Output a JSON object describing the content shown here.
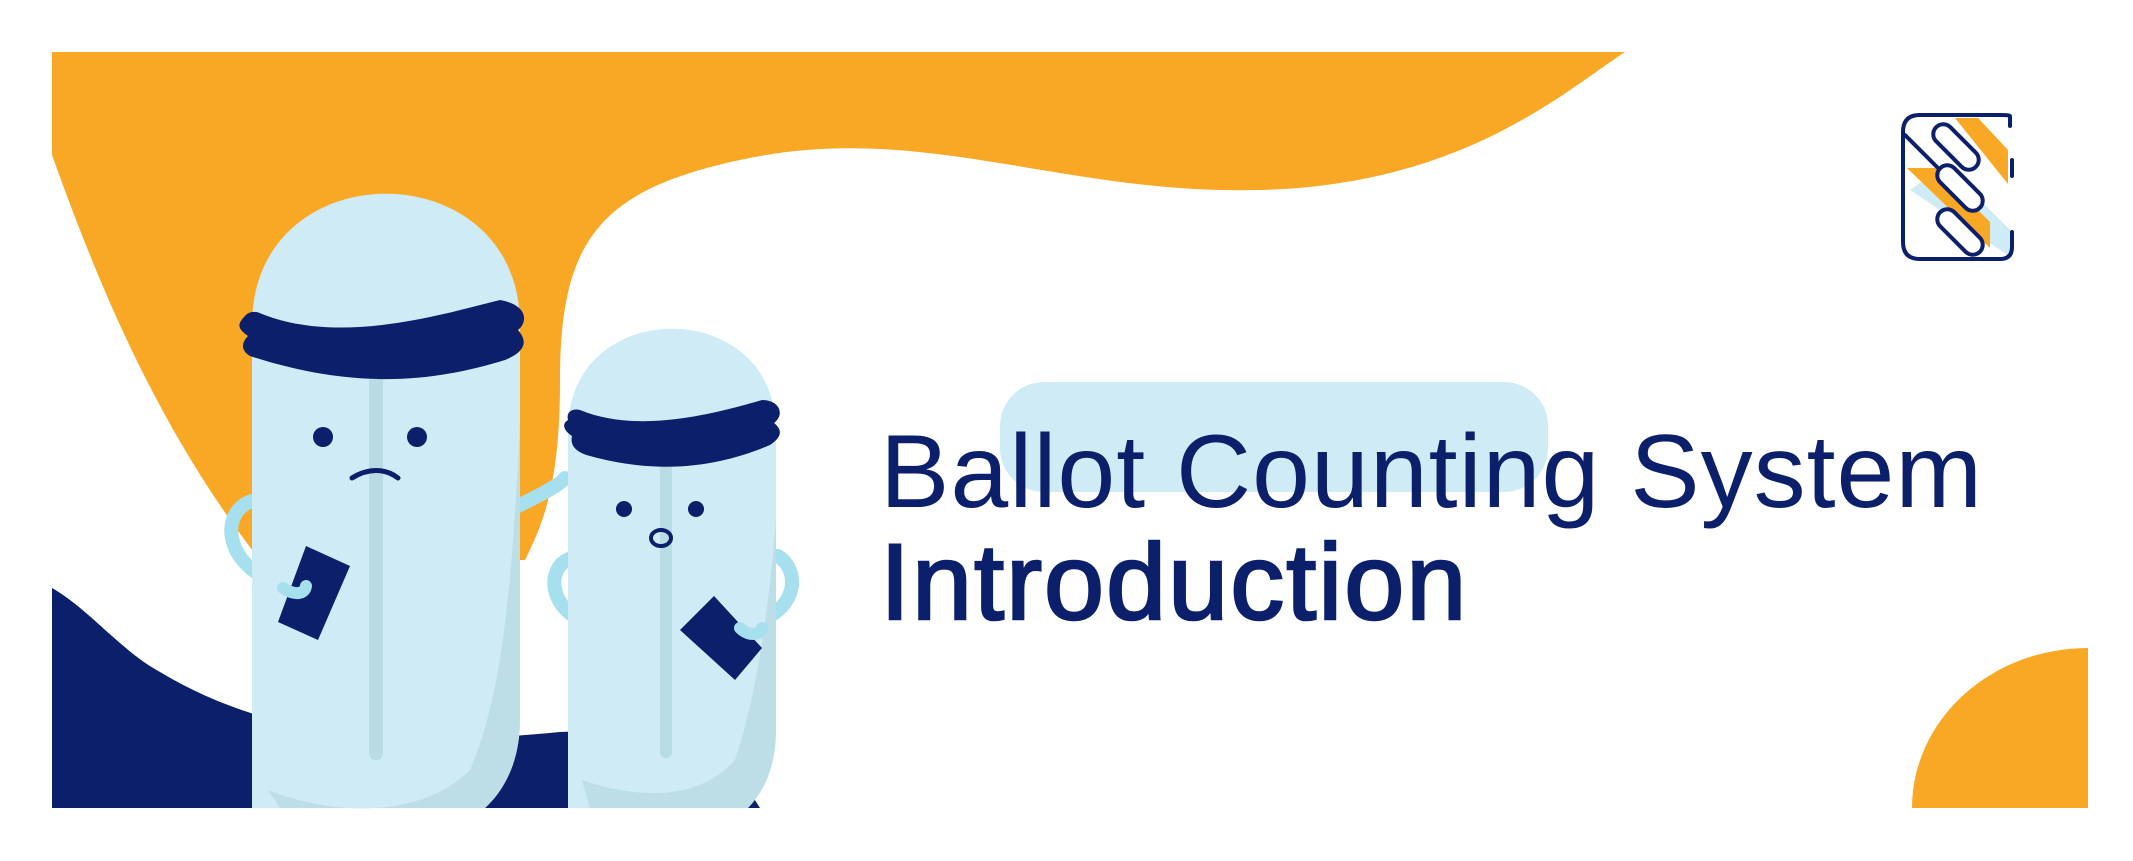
{
  "banner": {
    "title": "Ballot Counting System",
    "subtitle": "Introduction"
  },
  "logo": {
    "icon": "paperclip-chain-logo-icon"
  },
  "characters": [
    {
      "name": "tall-ballot-box-character",
      "holds": "ballot-card-icon"
    },
    {
      "name": "short-ballot-box-character",
      "holds": "ballot-card-icon"
    }
  ],
  "colors": {
    "orange": "#f9a825",
    "navy": "#0b1f6b",
    "light_blue": "#cfebf5",
    "arm_blue": "#a6e0ee",
    "shadow_blue": "#b9dbe3"
  }
}
